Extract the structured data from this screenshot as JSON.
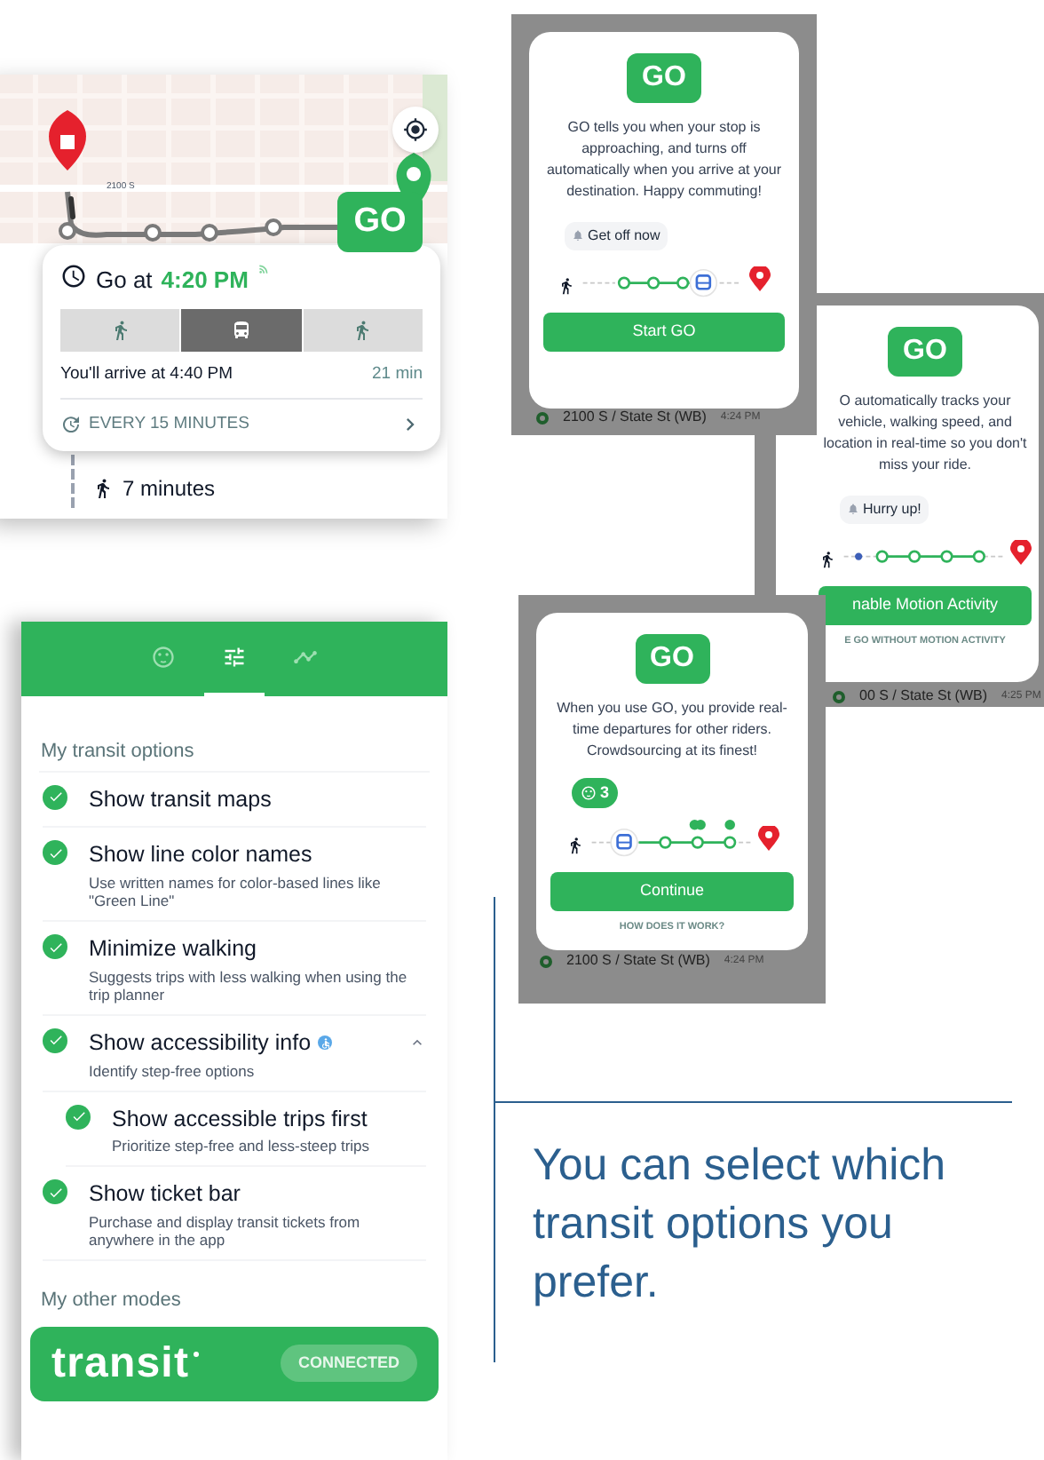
{
  "trip_card": {
    "map_label": "2100 S",
    "go_button": "GO",
    "go_prefix": "Go at",
    "go_time": "4:20 PM",
    "segments": [
      {
        "kind": "walk",
        "selected": false
      },
      {
        "kind": "transit",
        "selected": true
      },
      {
        "kind": "walk",
        "selected": false
      }
    ],
    "arrival": "You'll arrive at 4:40 PM",
    "duration": "21 min",
    "frequency": "EVERY 15 MINUTES",
    "walk_time": "7 minutes"
  },
  "go_dialogs": [
    {
      "badge": "GO",
      "body": "GO tells you when your stop is approaching, and turns off automatically when you arrive at your destination. Happy commuting!",
      "bubble": {
        "kind": "alert",
        "text": "Get off now"
      },
      "kind": "approaching",
      "button": "Start GO",
      "stop": "2100 S / State St (WB)",
      "time": "4:24 PM"
    },
    {
      "badge": "GO",
      "body": "O automatically tracks your vehicle, walking speed, and location in real-time so you don't miss your ride.",
      "bubble": {
        "kind": "alert",
        "text": "Hurry up!"
      },
      "kind": "tracking",
      "button": "nable Motion Activity",
      "link": "E GO WITHOUT MOTION ACTIVITY",
      "stop": "00 S / State St (WB)",
      "time": "4:25 PM"
    },
    {
      "badge": "GO",
      "body": "When you use GO, you provide real-time departures for other riders. Crowdsourcing at its finest!",
      "bubble": {
        "kind": "riders",
        "text": "3"
      },
      "kind": "crowdsourcing",
      "button": "Continue",
      "link": "HOW DOES IT WORK?",
      "stop": "2100 S / State St (WB)",
      "time": "4:24 PM"
    }
  ],
  "settings": {
    "tabs": [
      {
        "kind": "profile",
        "selected": false
      },
      {
        "kind": "options",
        "selected": true
      },
      {
        "kind": "routes",
        "selected": false
      }
    ],
    "section": "My transit options",
    "options": [
      {
        "title": "Show transit maps",
        "checked": true,
        "accessible_badge": false
      },
      {
        "title": "Show line color names",
        "subtitle": "Use written names for color-based lines like \"Green Line\"",
        "checked": true,
        "accessible_badge": false
      },
      {
        "title": "Minimize walking",
        "subtitle": "Suggests trips with less walking when using the trip planner",
        "checked": true,
        "accessible_badge": false
      },
      {
        "title": "Show accessibility info",
        "subtitle": "Identify step-free options",
        "checked": true,
        "accessible_badge": true,
        "expanded": true,
        "children": [
          {
            "title": "Show accessible trips first",
            "subtitle": "Prioritize step-free and less-steep trips",
            "checked": true,
            "accessible_badge": false
          }
        ]
      },
      {
        "title": "Show ticket bar",
        "subtitle": "Purchase and display transit tickets from anywhere in the app",
        "checked": true,
        "accessible_badge": false
      }
    ],
    "other_section": "My other modes",
    "partner": {
      "logo": "transit",
      "status": "CONNECTED"
    }
  },
  "caption": "You can select which transit options you prefer."
}
